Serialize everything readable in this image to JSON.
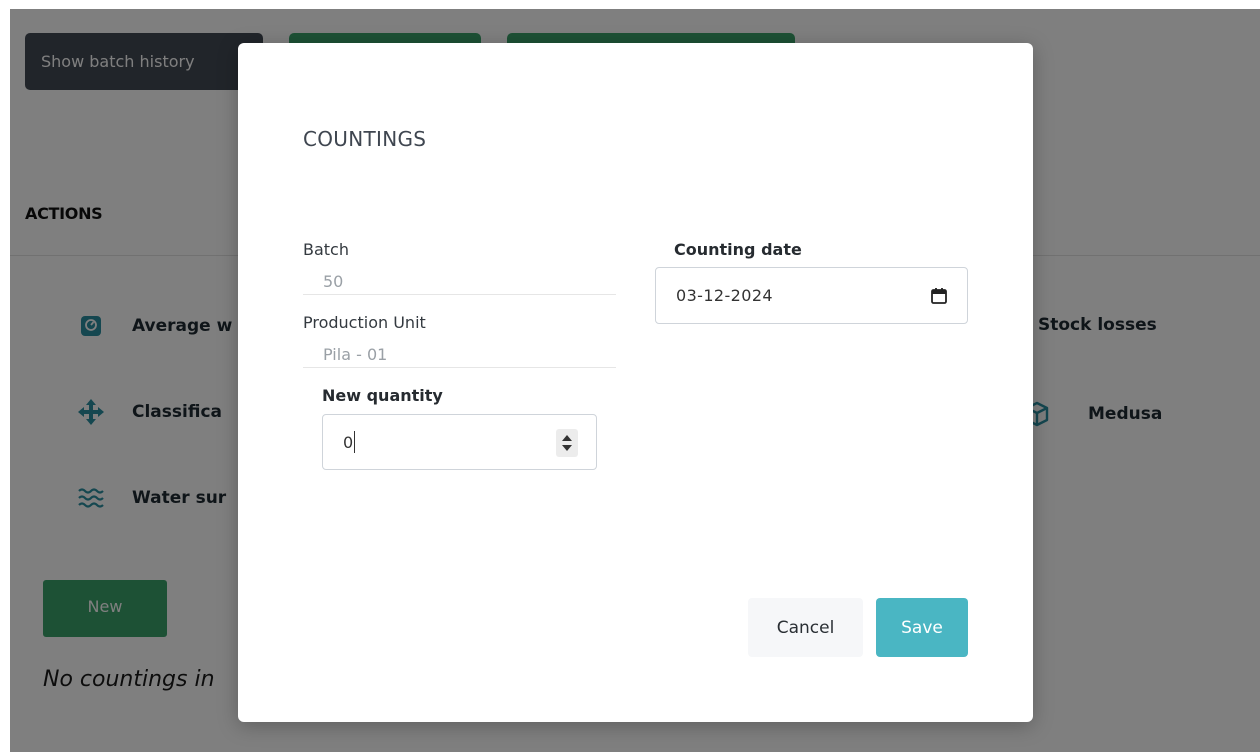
{
  "background": {
    "buttons": {
      "show_batch_history": "Show batch history",
      "green_button_1": "",
      "green_button_2": ""
    },
    "actions": {
      "title": "ACTIONS",
      "average_weight": "Average w",
      "classification": "Classifica",
      "water_surface": "Water sur",
      "stock_losses": "Stock losses",
      "medusa": "Medusa"
    },
    "new_button": "New",
    "empty_message": "No countings in"
  },
  "modal": {
    "title": "COUNTINGS",
    "batch": {
      "label": "Batch",
      "value": "50"
    },
    "production_unit": {
      "label": "Production Unit",
      "value": "Pila - 01"
    },
    "new_quantity": {
      "label": "New quantity",
      "value": "0"
    },
    "counting_date": {
      "label": "Counting date",
      "value": "03-12-2024"
    },
    "cancel_label": "Cancel",
    "save_label": "Save"
  },
  "colors": {
    "primary_green": "#3aa36b",
    "save_teal": "#4ab6c3",
    "dark_button": "#434a54",
    "icon_teal": "#2a8fa0"
  },
  "icons": {
    "average_weight": "weight-scale-icon",
    "classification": "move-arrows-icon",
    "water_surface": "water-waves-icon",
    "medusa": "cube-icon",
    "counting_date": "calendar-icon",
    "quantity_stepper": "spinner-arrows-icon"
  }
}
